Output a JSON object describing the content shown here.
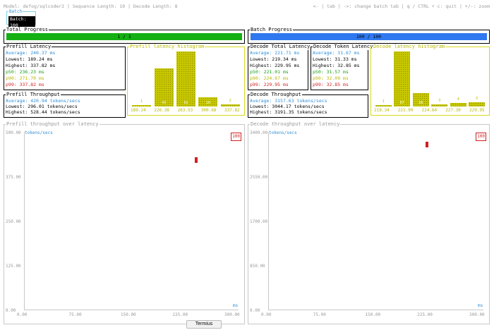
{
  "header": {
    "info": "Model: defog/sqlcoder2 | Sequence Length: 10 | Decode Length: 8",
    "help": "<- | tab | ->: change batch tab | q / CTRL + c: quit | +/-: zoom",
    "tab_group": "Batch",
    "tab_label": "Batch: 100"
  },
  "progress": {
    "total_title": "Total Progress",
    "total_text": "1 / 1",
    "total_fraction": 1.0,
    "batch_title": "Batch Progress",
    "batch_text": "100 / 100",
    "batch_fraction": 1.0,
    "total_color": "#14b014",
    "batch_color": "#2f78ef"
  },
  "prefill_latency": {
    "title": "Prefill Latency",
    "average": "Average: 240.37 ms",
    "lowest": "Lowest:  189.24 ms",
    "highest": "Highest: 337.82 ms",
    "p50": "p50:     236.23 ms",
    "p90": "p90:     271.70 ms",
    "p99": "p99:     337.82 ms"
  },
  "prefill_hist": {
    "title": "Prefill latency histogram",
    "values": [
      1,
      43,
      62,
      10,
      2
    ],
    "labels": [
      "1",
      "43",
      "62",
      "10",
      "2"
    ],
    "ticks": [
      "189.24",
      "226.38",
      "263.53",
      "300.68",
      "337.82"
    ],
    "max": 62
  },
  "prefill_throughput": {
    "title": "Prefill Throughput",
    "average": "Average: 420.94 tokens/secs",
    "lowest": "Lowest:  296.01 tokens/secs",
    "highest": "Highest: 528.44 tokens/secs"
  },
  "decode_latency": {
    "title": "Decode Total Latency",
    "average": "Average: 221.71 ms",
    "lowest": "Lowest:  219.34 ms",
    "highest": "Highest: 229.95 ms",
    "p50": "p50:     221.01 ms",
    "p90": "p90:     224.67 ms",
    "p99": "p99:     229.95 ms"
  },
  "decode_token_latency": {
    "title": "Decode Token Latency",
    "average": "Average: 31.67 ms",
    "lowest": "Lowest:  31.33 ms",
    "highest": "Highest: 32.85 ms",
    "p50": "p50:     31.57 ms",
    "p90": "p90:     32.09 ms",
    "p99": "p99:     32.85 ms"
  },
  "decode_hist": {
    "title": "Decode latency histogram",
    "values": [
      1,
      67,
      16,
      3,
      4,
      5
    ],
    "labels": [
      "1",
      "67",
      "16",
      "3",
      "4",
      "5"
    ],
    "ticks": [
      "219.34",
      "221.99",
      "224.64",
      "227.30",
      "229.95"
    ],
    "max": 67
  },
  "decode_throughput": {
    "title": "Decode Throughput",
    "average": "Average: 3157.63 tokens/secs",
    "lowest": "Lowest:  3044.17 tokens/secs",
    "highest": "Highest: 3191.35 tokens/secs"
  },
  "chart_data": [
    {
      "type": "scatter",
      "title": "Prefill throughput over latency",
      "ylabel": "tokens/secs",
      "xlabel": "ms",
      "y_ticks": [
        "500.00",
        "375.00",
        "250.00",
        "125.00",
        "0.00"
      ],
      "x_ticks": [
        "0.00",
        "75.00",
        "150.00",
        "225.00",
        "300.00"
      ],
      "xlim": [
        0,
        300
      ],
      "ylim": [
        0,
        500
      ],
      "legend": "100",
      "series": [
        {
          "name": "100",
          "x": [
            240.37
          ],
          "y": [
            420.94
          ]
        }
      ]
    },
    {
      "type": "scatter",
      "title": "Decode throughput over latency",
      "ylabel": "tokens/secs",
      "xlabel": "ms",
      "y_ticks": [
        "3400.00",
        "2550.00",
        "1700.00",
        "850.00",
        "0.00"
      ],
      "x_ticks": [
        "0.00",
        "75.00",
        "150.00",
        "225.00",
        "300.00"
      ],
      "xlim": [
        0,
        300
      ],
      "ylim": [
        0,
        3400
      ],
      "legend": "100",
      "series": [
        {
          "name": "100",
          "x": [
            221.71
          ],
          "y": [
            3157.63
          ]
        }
      ]
    }
  ],
  "taskbar": {
    "label": "Termius"
  }
}
